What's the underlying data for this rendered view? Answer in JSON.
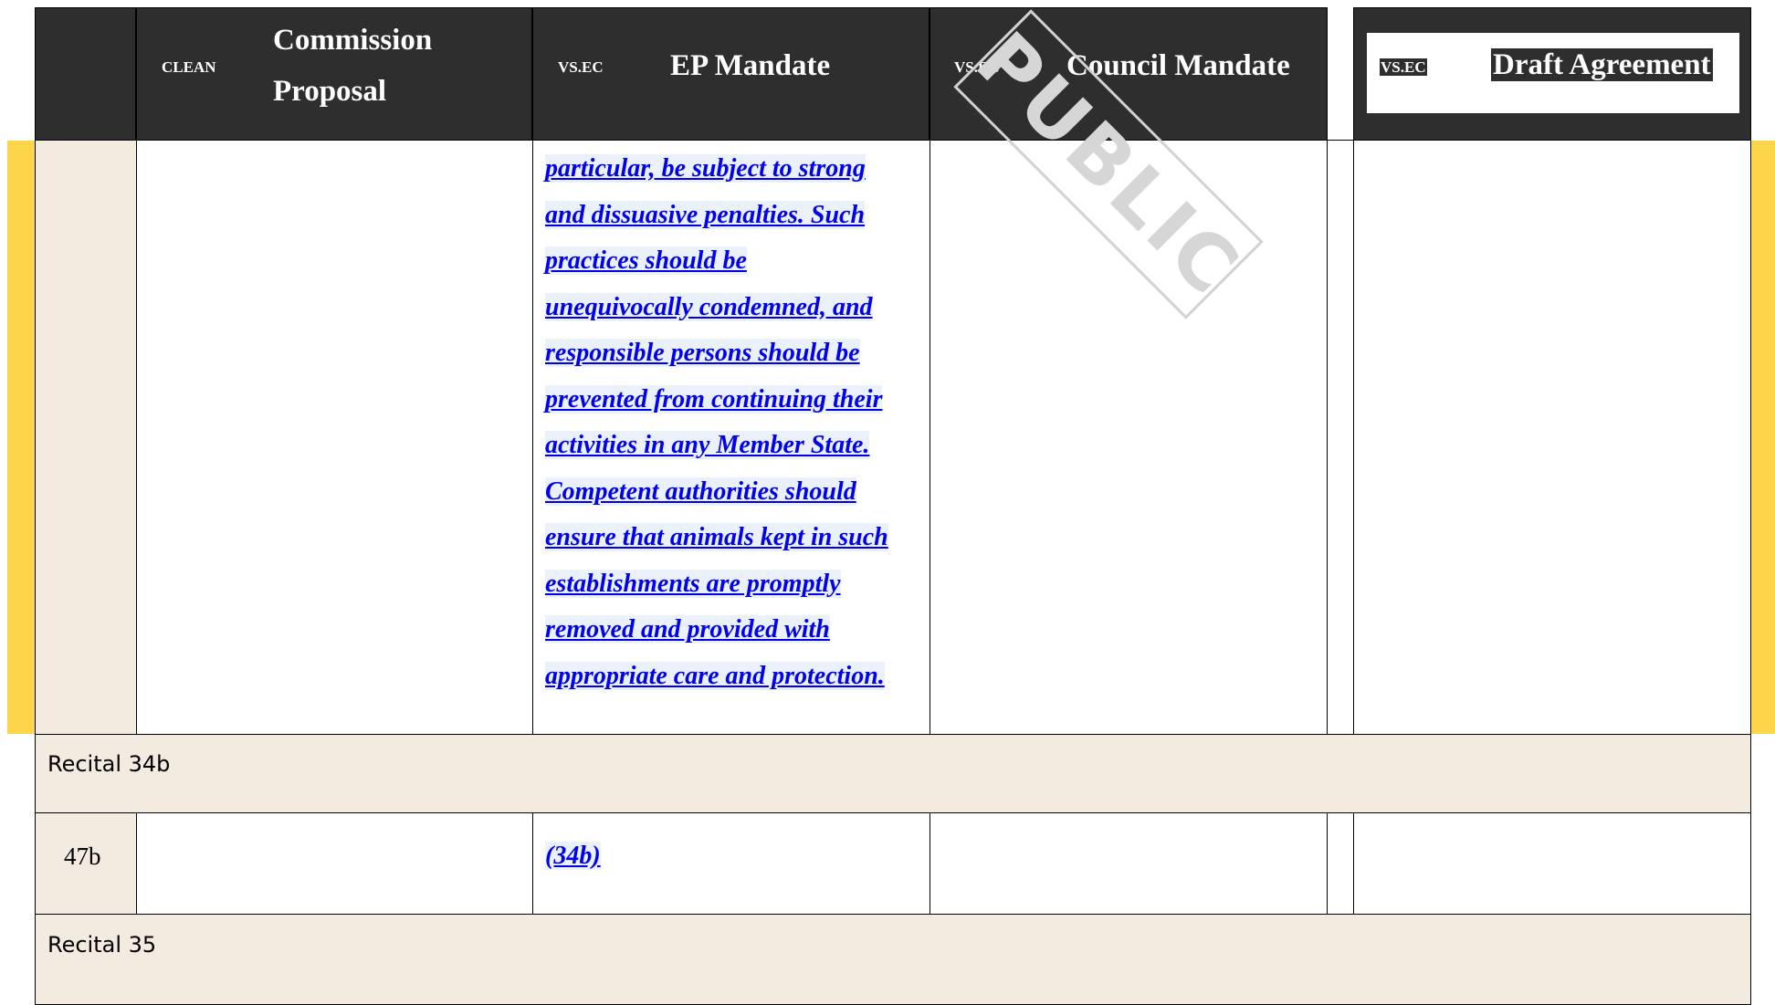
{
  "header": {
    "col1_tag": "CLEAN",
    "col1_title_line1": "Commission",
    "col1_title_line2": "Proposal",
    "col2_tag": "VS.EC",
    "col2_title": "EP Mandate",
    "col3_tag": "VS.EC",
    "col3_title": "Council Mandate",
    "col4_tag": "VS.EC",
    "col4_title": "Draft Agreement"
  },
  "watermark": "PUBLIC",
  "ep_mandate_lines": [
    "particular, be subject to strong",
    "and dissuasive penalties. Such",
    "practices should be",
    "unequivocally condemned, and",
    "responsible persons should be",
    "prevented from continuing their",
    "activities in any Member State.",
    "Competent authorities should",
    "ensure that animals kept in such",
    "establishments are promptly",
    "removed and provided with",
    "appropriate care and protection."
  ],
  "rows": [
    {
      "recital": "Recital 34b",
      "number": "47b",
      "ep_mandate": "(34b)"
    },
    {
      "recital": "Recital 35"
    }
  ],
  "colors": {
    "header_bg": "#2e2e2e",
    "recital_bg": "#f4ebe0",
    "amendment_text": "#0000ee",
    "highlight_bar": "#fdd54a"
  }
}
